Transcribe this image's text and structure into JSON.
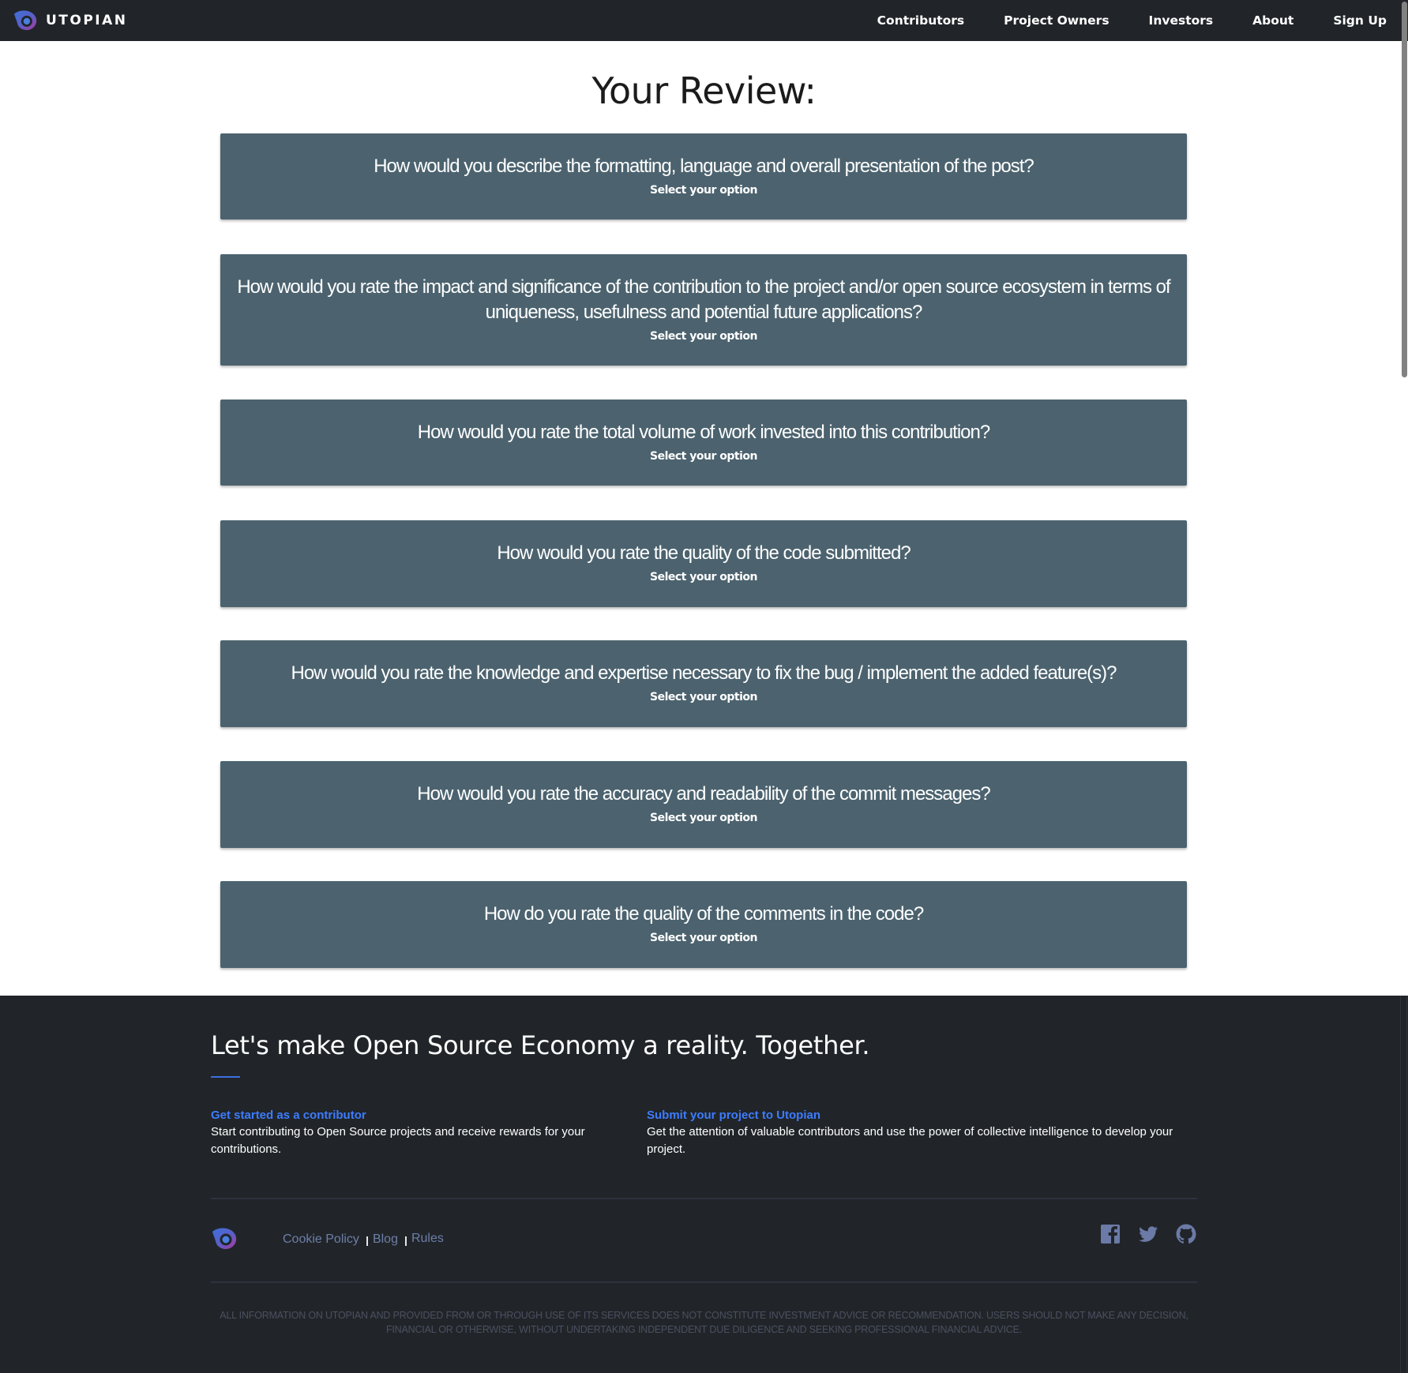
{
  "navbar": {
    "brand": "UTOPIAN",
    "logo_icon": "utopian-eye-logo",
    "links": [
      "Contributors",
      "Project Owners",
      "Investors",
      "About",
      "Sign Up"
    ]
  },
  "main": {
    "title": "Your Review:",
    "select_label": "Select your option",
    "questions": [
      "How would you describe the formatting, language and overall presentation of the post?",
      "How would you rate the impact and significance of the contribution to the project and/or open source ecosystem in terms of uniqueness, usefulness and potential future applications?",
      "How would you rate the total volume of work invested into this contribution?",
      "How would you rate the quality of the code submitted?",
      "How would you rate the knowledge and expertise necessary to fix the bug / implement the added feature(s)?",
      "How would you rate the accuracy and readability of the commit messages?",
      "How do you rate the quality of the comments in the code?"
    ]
  },
  "footer": {
    "heading": "Let's make Open Source Economy a reality. Together.",
    "accent_color": "#3d7cff",
    "cta_contributor": {
      "title": "Get started as a contributor",
      "text": "Start contributing to Open Source projects and receive rewards for your contributions."
    },
    "cta_project": {
      "title": "Submit your project to Utopian",
      "text": "Get the attention of valuable contributors and use the power of collective intelligence to develop your project."
    },
    "links": [
      "Cookie Policy",
      "Blog",
      "Rules"
    ],
    "social_icons": [
      "facebook-icon",
      "twitter-icon",
      "github-icon"
    ],
    "disclaimer": "ALL INFORMATION ON UTOPIAN AND PROVIDED FROM OR THROUGH USE OF ITS SERVICES DOES NOT CONSTITUTE INVESTMENT ADVICE OR RECOMMENDATION. USERS SHOULD NOT MAKE ANY DECISION, FINANCIAL OR OTHERWISE, WITHOUT UNDERTAKING INDEPENDENT DUE DILIGENCE AND SEEKING PROFESSIONAL FINANCIAL ADVICE."
  }
}
